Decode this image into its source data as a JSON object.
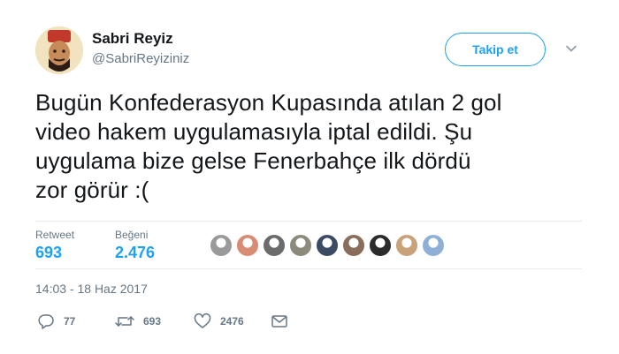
{
  "user": {
    "display_name": "Sabri Reyiz",
    "handle": "@SabriReyiziniz"
  },
  "follow_label": "Takip et",
  "tweet": {
    "text": "Bugün Konfederasyon Kupasında atılan 2 gol\nvideo hakem uygulamasıyla iptal edildi. Şu\nuygulama bize gelse Fenerbahçe ilk dördü\nzor görür :("
  },
  "stats": {
    "retweet_label": "Retweet",
    "retweet_count": "693",
    "likes_label": "Beğeni",
    "likes_count": "2.476"
  },
  "liker_avatar_colors": [
    "#9a9a9a",
    "#d98b73",
    "#6b6b6b",
    "#8d8a7c",
    "#3a4b63",
    "#8a6d5a",
    "#2b2b2b",
    "#c9a27a",
    "#8fb0d6"
  ],
  "timestamp": "14:03 - 18 Haz 2017",
  "actions": {
    "reply_count": "77",
    "retweet_count": "693",
    "like_count": "2476"
  },
  "colors": {
    "accent": "#1da1f2",
    "secondary_text": "#657786"
  }
}
